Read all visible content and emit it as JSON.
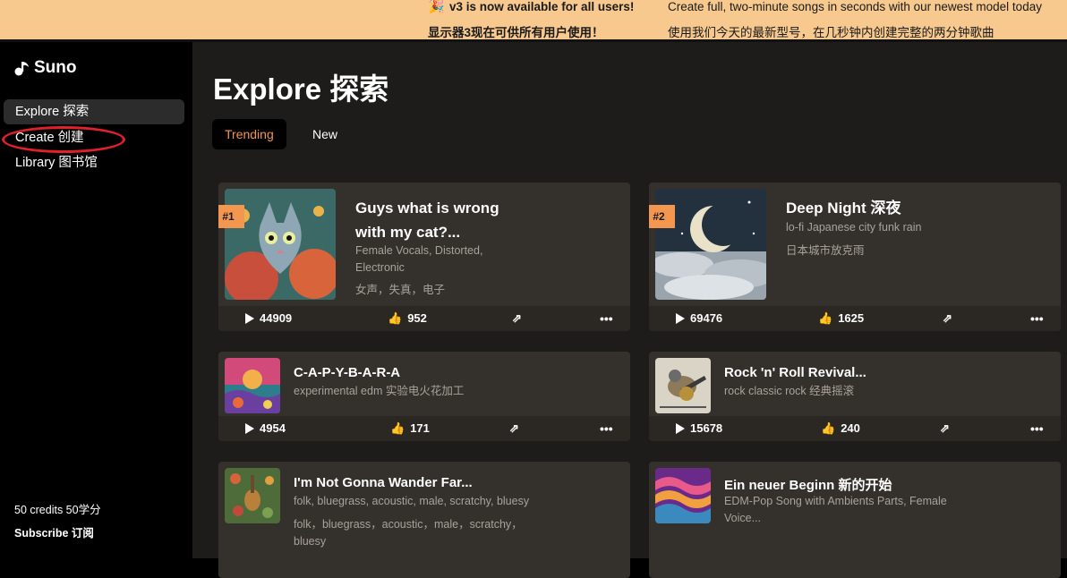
{
  "banner": {
    "announce_en": "v3 is now available for all users!",
    "announce_zh": "显示器3现在可供所有用户使用！",
    "desc_en": "Create full, two-minute songs in seconds with our newest model today",
    "desc_zh": "使用我们今天的最新型号，在几秒钟内创建完整的两分钟歌曲",
    "icon": "party-horn-icon"
  },
  "sidebar": {
    "brand": "Suno",
    "nav": [
      {
        "label": "Explore 探索",
        "active": true
      },
      {
        "label": "Create 创建",
        "active": false
      },
      {
        "label": "Library 图书馆",
        "active": false
      }
    ],
    "credits": "50 credits 50学分",
    "subscribe": "Subscribe 订阅"
  },
  "main": {
    "title": "Explore 探索",
    "tabs": [
      {
        "label": "Trending",
        "active": true
      },
      {
        "label": "New",
        "active": false
      }
    ]
  },
  "songs": [
    {
      "rank": "#1",
      "title_line1": "Guys what is wrong",
      "title_line2": "with my cat?...",
      "tags_line1": "Female Vocals, Distorted,",
      "tags_line2": "Electronic",
      "tags_zh": "女声，失真，电子",
      "plays": "44909",
      "likes": "952"
    },
    {
      "rank": "#2",
      "title": "Deep Night  深夜",
      "tags": "lo-fi Japanese city funk rain",
      "tags_zh": "日本城市放克雨",
      "plays": "69476",
      "likes": "1625"
    },
    {
      "title": "C-A-P-Y-B-A-R-A",
      "tags": "experimental edm 实验电火花加工",
      "plays": "4954",
      "likes": "171"
    },
    {
      "title": "Rock 'n' Roll Revival...",
      "tags": "rock classic rock 经典摇滚",
      "plays": "15678",
      "likes": "240"
    },
    {
      "title": "I'm Not Gonna Wander Far...",
      "tags": "folk, bluegrass, acoustic, male, scratchy, bluesy",
      "tags_zh_line1": "folk，bluegrass，acoustic，male，scratchy，",
      "tags_zh_line2": "bluesy"
    },
    {
      "title": "Ein neuer Beginn  新的开始",
      "tags_line1": "EDM-Pop Song with Ambients Parts, Female",
      "tags_line2": "Voice..."
    }
  ],
  "colors": {
    "accent": "#f29650",
    "banner": "#f8c98e",
    "card": "#34302b",
    "annotation": "#e0202a"
  }
}
